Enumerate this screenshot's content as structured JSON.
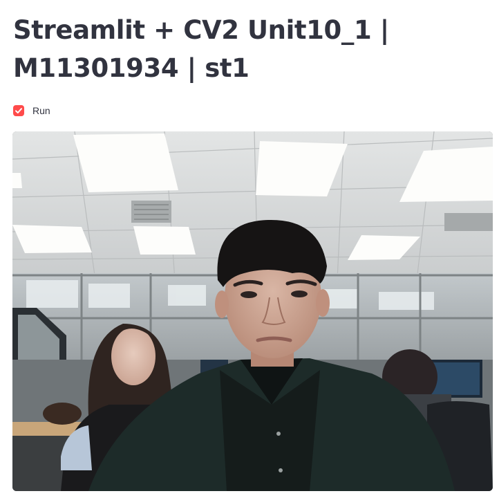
{
  "header": {
    "title_line1": "Streamlit + CV2 Unit10_1 |",
    "title_line2": "M11301934 | st1"
  },
  "controls": {
    "run_checkbox": {
      "label": "Run",
      "checked": true,
      "icon": "checkmark-icon"
    }
  },
  "colors": {
    "accent": "#ff4b4b",
    "text": "#31333f",
    "background": "#ffffff"
  },
  "video": {
    "feed_icon": "webcam-frame"
  }
}
